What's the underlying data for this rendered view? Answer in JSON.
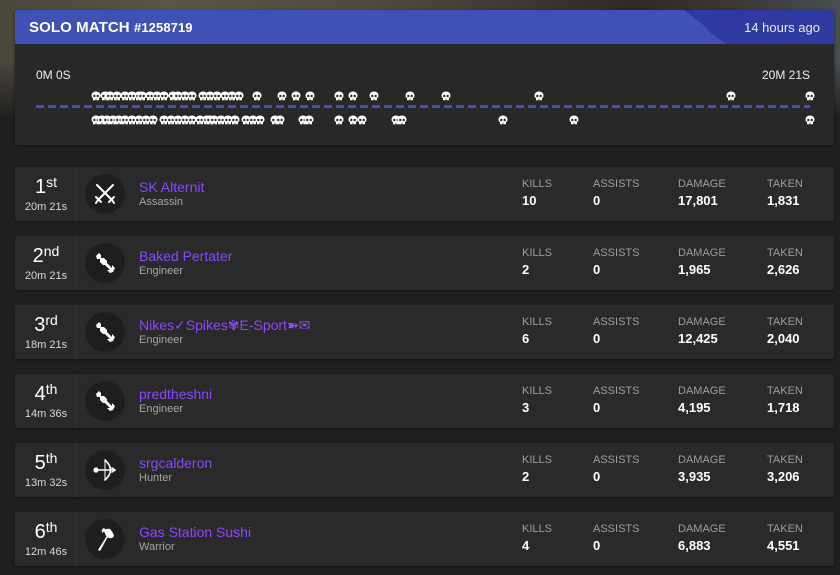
{
  "match": {
    "title": "SOLO MATCH",
    "id": "#1258719",
    "time_ago": "14 hours ago",
    "accent_color": "#3f51b5",
    "timeline": {
      "start_label": "0M 0S",
      "end_label": "20M 21S",
      "duration_seconds": 1221,
      "top_events_fraction": [
        0.0,
        0.012,
        0.02,
        0.03,
        0.04,
        0.05,
        0.06,
        0.065,
        0.075,
        0.085,
        0.095,
        0.108,
        0.115,
        0.125,
        0.135,
        0.15,
        0.16,
        0.17,
        0.18,
        0.19,
        0.2,
        0.225,
        0.26,
        0.28,
        0.3,
        0.34,
        0.36,
        0.39,
        0.44,
        0.49,
        0.62,
        0.89,
        1.0
      ],
      "bottom_events_fraction": [
        0.0,
        0.008,
        0.016,
        0.024,
        0.032,
        0.04,
        0.05,
        0.06,
        0.07,
        0.08,
        0.095,
        0.105,
        0.115,
        0.125,
        0.135,
        0.145,
        0.155,
        0.16,
        0.165,
        0.175,
        0.185,
        0.195,
        0.21,
        0.22,
        0.23,
        0.25,
        0.258,
        0.29,
        0.298,
        0.34,
        0.36,
        0.372,
        0.42,
        0.428,
        0.57,
        0.67,
        1.0
      ]
    }
  },
  "stat_labels": {
    "kills": "KILLS",
    "assists": "ASSISTS",
    "damage": "DAMAGE",
    "taken": "TAKEN"
  },
  "players": [
    {
      "rank_num": "1",
      "rank_suffix": "st",
      "survived": "20m 21s",
      "name": "SK Alternit",
      "class": "Assassin",
      "icon": "crossed-swords-icon",
      "kills": "10",
      "assists": "0",
      "damage": "17,801",
      "taken": "1,831"
    },
    {
      "rank_num": "2",
      "rank_suffix": "nd",
      "survived": "20m 21s",
      "name": "Baked Pertater",
      "class": "Engineer",
      "icon": "wrench-icon",
      "kills": "2",
      "assists": "0",
      "damage": "1,965",
      "taken": "2,626"
    },
    {
      "rank_num": "3",
      "rank_suffix": "rd",
      "survived": "18m 21s",
      "name": "Nikes✓Spikes✾E-Sport➽✉",
      "class": "Engineer",
      "icon": "wrench-icon",
      "kills": "6",
      "assists": "0",
      "damage": "12,425",
      "taken": "2,040"
    },
    {
      "rank_num": "4",
      "rank_suffix": "th",
      "survived": "14m 36s",
      "name": "predtheshni",
      "class": "Engineer",
      "icon": "wrench-icon",
      "kills": "3",
      "assists": "0",
      "damage": "4,195",
      "taken": "1,718"
    },
    {
      "rank_num": "5",
      "rank_suffix": "th",
      "survived": "13m 32s",
      "name": "srgcalderon",
      "class": "Hunter",
      "icon": "bow-icon",
      "kills": "2",
      "assists": "0",
      "damage": "3,935",
      "taken": "3,206"
    },
    {
      "rank_num": "6",
      "rank_suffix": "th",
      "survived": "12m 46s",
      "name": "Gas Station Sushi",
      "class": "Warrior",
      "icon": "axe-icon",
      "kills": "4",
      "assists": "0",
      "damage": "6,883",
      "taken": "4,551"
    }
  ]
}
